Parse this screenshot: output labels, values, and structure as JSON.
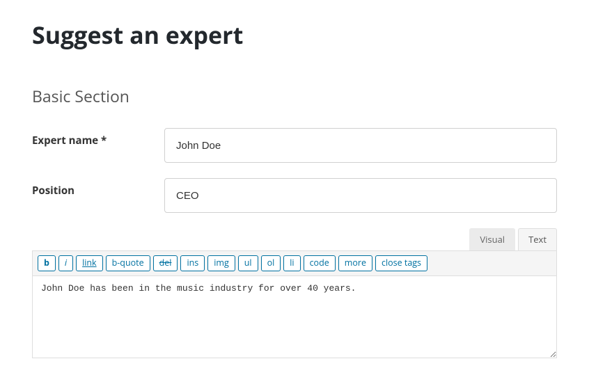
{
  "page": {
    "title": "Suggest an expert",
    "section_title": "Basic Section"
  },
  "fields": {
    "expert_name": {
      "label": "Expert name *",
      "value": "John Doe"
    },
    "position": {
      "label": "Position",
      "value": "CEO"
    }
  },
  "editor": {
    "tabs": {
      "visual": "Visual",
      "text": "Text"
    },
    "buttons": {
      "b": "b",
      "i": "i",
      "link": "link",
      "bquote": "b-quote",
      "del": "del",
      "ins": "ins",
      "img": "img",
      "ul": "ul",
      "ol": "ol",
      "li": "li",
      "code": "code",
      "more": "more",
      "close": "close tags"
    },
    "content": "John Doe has been in the music industry for over 40 years."
  }
}
